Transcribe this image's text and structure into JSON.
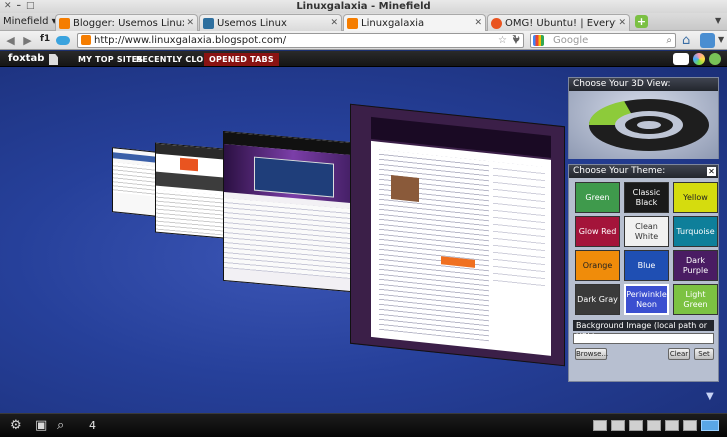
{
  "window": {
    "title": "Linuxgalaxia - Minefield"
  },
  "browser": {
    "app_menu": "Minefield",
    "tabs": [
      {
        "label": "Blogger: Usemos Linux - Cr",
        "favicon_color": "#f57d00"
      },
      {
        "label": "Usemos Linux",
        "favicon_color": "#2e6f9e"
      },
      {
        "label": "Linuxgalaxia",
        "favicon_color": "#f57d00",
        "active": true
      },
      {
        "label": "OMG! Ubuntu! | Everything",
        "favicon_color": "#e95420"
      }
    ],
    "nav": {
      "f1_label": "f1",
      "url": "http://www.linuxgalaxia.blogspot.com/",
      "search_placeholder": "Google"
    }
  },
  "foxtab": {
    "logo": "foxtab",
    "tabs": [
      {
        "label": "MY TOP SITES"
      },
      {
        "label": "RECENTLY CLOSED"
      },
      {
        "label": "OPENED TABS",
        "selected": true
      }
    ]
  },
  "panels": {
    "view3d": {
      "title": "Choose Your 3D View:"
    },
    "theme": {
      "title": "Choose Your Theme:",
      "themes": [
        {
          "label": "Green",
          "color": "#3f9a4c"
        },
        {
          "label": "Classic Black",
          "color": "#1a1a1a"
        },
        {
          "label": "Yellow",
          "color": "#d5dc0e"
        },
        {
          "label": "Glow Red",
          "color": "#a4143a"
        },
        {
          "label": "Clean White",
          "color": "#f1f1f1"
        },
        {
          "label": "Turquoise",
          "color": "#0e7f9a"
        },
        {
          "label": "Orange",
          "color": "#f08c0a"
        },
        {
          "label": "Blue",
          "color": "#1f4fb3"
        },
        {
          "label": "Dark Purple",
          "color": "#4a1c63"
        },
        {
          "label": "Dark Gray",
          "color": "#3a3a3a"
        },
        {
          "label": "Periwinkle Neon",
          "color": "#3b4fd0"
        },
        {
          "label": "Light Green",
          "color": "#7cc242"
        }
      ],
      "bg_label": "Background Image (local path or URL):",
      "bg_value": "",
      "browse": "Browse...",
      "clear": "Clear",
      "set": "Set"
    }
  },
  "bottom": {
    "tab_count": "4"
  }
}
